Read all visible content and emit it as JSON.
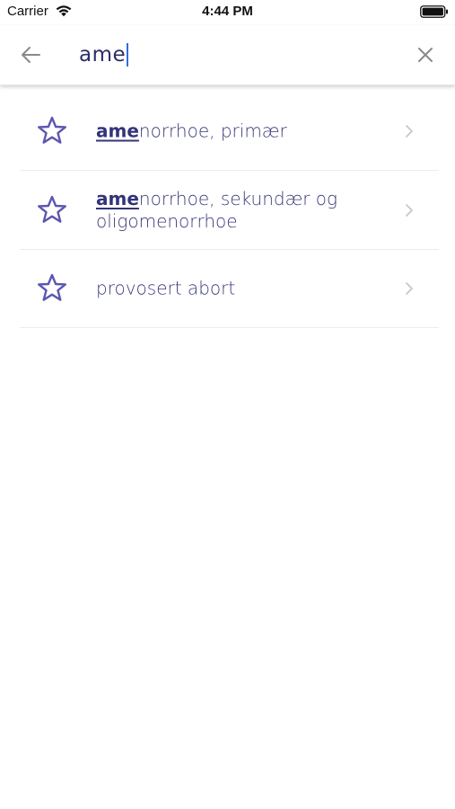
{
  "status_bar": {
    "carrier": "Carrier",
    "time": "4:44 PM",
    "icons": [
      "wifi-icon",
      "battery-icon"
    ]
  },
  "search": {
    "value": "ame",
    "back_icon": "arrow-left-icon",
    "clear_icon": "close-icon"
  },
  "results": [
    {
      "match": "ame",
      "rest": "norrhoe, primær",
      "icon": "star-icon",
      "favorite": false
    },
    {
      "match": "ame",
      "rest": "norrhoe, sekundær og oligomenorrhoe",
      "icon": "star-icon",
      "favorite": false
    },
    {
      "match": "",
      "rest": "provosert abort",
      "icon": "star-icon",
      "favorite": false
    }
  ],
  "colors": {
    "accent": "#5b57b0",
    "text": "#3a3a7a",
    "caret": "#2f6fe0",
    "chevron": "#c7c7cc"
  }
}
